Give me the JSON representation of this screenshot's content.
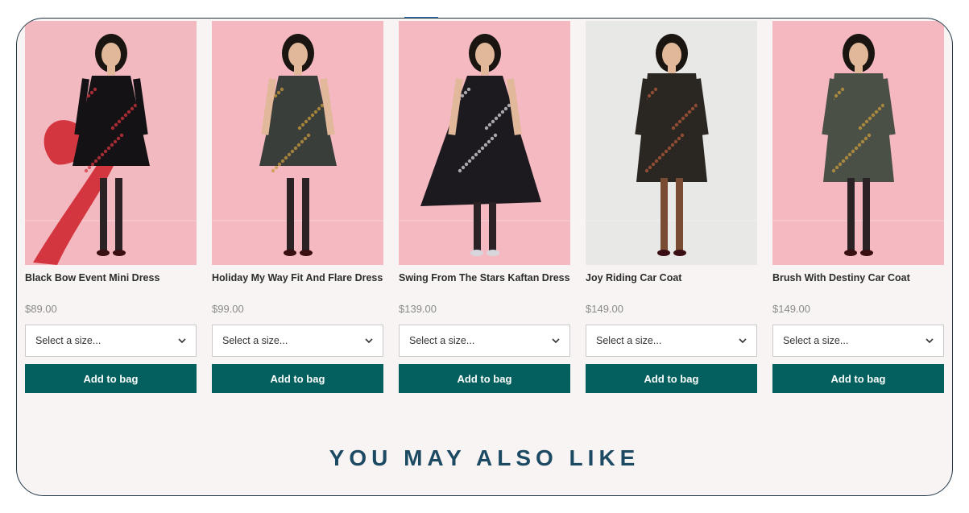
{
  "products": [
    {
      "name": "Black Bow Event Mini Dress",
      "price": "$89.00",
      "size_placeholder": "Select a size...",
      "button": "Add to bag",
      "bg": "#f3b9c0",
      "dress": "#151215",
      "accent": "#d4363f"
    },
    {
      "name": "Holiday My Way Fit And Flare Dress",
      "price": "$99.00",
      "size_placeholder": "Select a size...",
      "button": "Add to bag",
      "bg": "#f5b8c1",
      "dress": "#3a3e3a",
      "accent": "#c99a3c"
    },
    {
      "name": "Swing From The Stars Kaftan Dress",
      "price": "$139.00",
      "size_placeholder": "Select a size...",
      "button": "Add to bag",
      "bg": "#f4b9c1",
      "dress": "#1c1a1e",
      "accent": "#d9d6da"
    },
    {
      "name": "Joy Riding Car Coat",
      "price": "$149.00",
      "size_placeholder": "Select a size...",
      "button": "Add to bag",
      "bg": "#e8e8e6",
      "dress": "#2a2622",
      "accent": "#b25a3b"
    },
    {
      "name": "Brush With Destiny Car Coat",
      "price": "$149.00",
      "size_placeholder": "Select a size...",
      "button": "Add to bag",
      "bg": "#f5b8c1",
      "dress": "#4a5046",
      "accent": "#c99a3c"
    }
  ],
  "section_heading": "YOU MAY ALSO LIKE",
  "colors": {
    "button": "#03605e",
    "heading": "#1d4a63",
    "price": "#8a8a8a"
  }
}
